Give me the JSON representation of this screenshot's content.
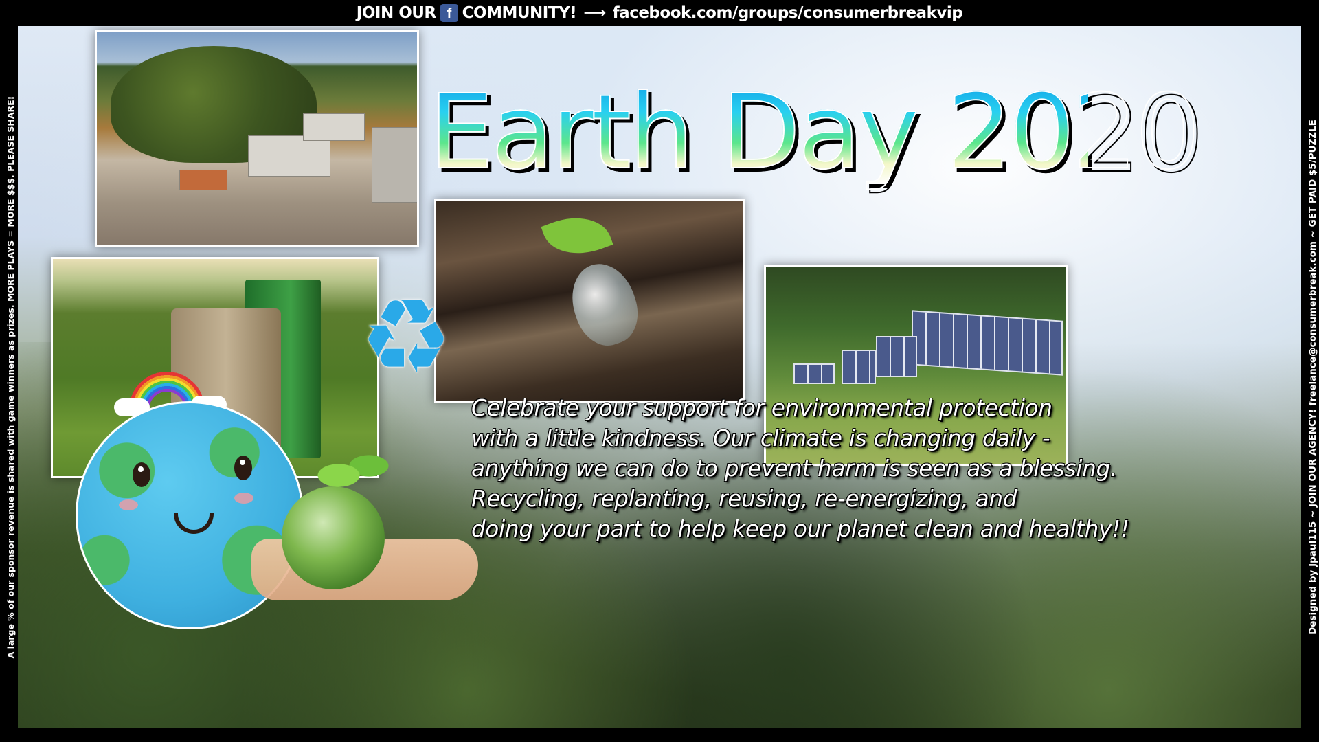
{
  "banner": {
    "join_text": "JOIN OUR",
    "fb_icon": "f",
    "community_text": "COMMUNITY!",
    "arrow": "⟶",
    "url": "facebook.com/groups/consumerbreakvip"
  },
  "side_left_text": "A large % of our sponsor revenue is shared with game winners as prizes. MORE PLAYS = MORE $$$. PLEASE SHARE!",
  "side_right_text": "Designed by Jpaul115 ~ JOIN OUR AGENCY! freelance@consumerbreak.com ~ GET PAID $5/PUZZLE",
  "title": "Earth Day 2020",
  "recycle_icon": "♻",
  "message_lines": [
    "Celebrate your support for environmental protection",
    "with a little kindness. Our climate is changing daily -",
    "anything we can do to prevent harm is seen as a blessing.",
    "Recycling, replanting, reusing, re-energizing, and",
    "doing your part to help keep our planet clean and healthy!!"
  ],
  "colors": {
    "title_top": "#10a4e8",
    "title_mid": "#5ce68c",
    "recycle": "#2aa9e8",
    "facebook": "#3b5998"
  },
  "icons": [
    "facebook-icon",
    "recycle-icon",
    "earth-mascot-icon",
    "rainbow-icon",
    "globe-sprout-icon"
  ]
}
